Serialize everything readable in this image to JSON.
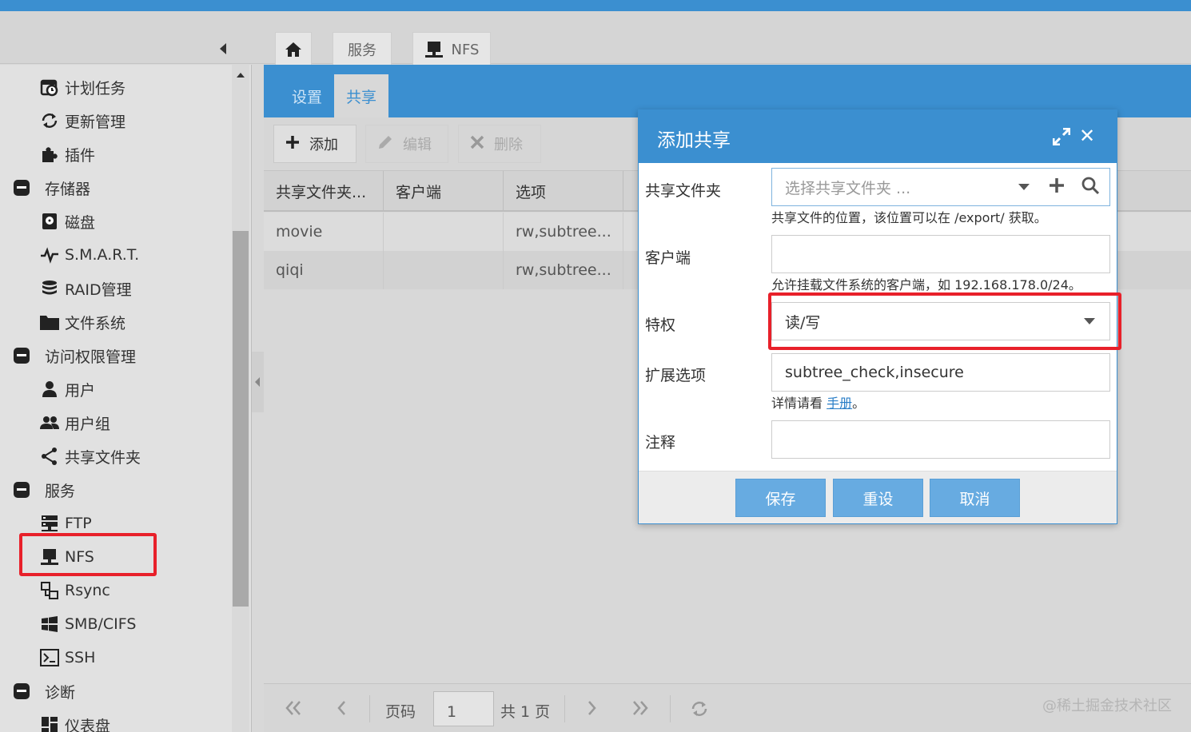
{
  "breadcrumb": {
    "service": "服务",
    "nfs": "NFS"
  },
  "sidebar": {
    "items": [
      {
        "label": "计划任务"
      },
      {
        "label": "更新管理"
      },
      {
        "label": "插件"
      },
      {
        "label": "存储器"
      },
      {
        "label": "磁盘"
      },
      {
        "label": "S.M.A.R.T."
      },
      {
        "label": "RAID管理"
      },
      {
        "label": "文件系统"
      },
      {
        "label": "访问权限管理"
      },
      {
        "label": "用户"
      },
      {
        "label": "用户组"
      },
      {
        "label": "共享文件夹"
      },
      {
        "label": "服务"
      },
      {
        "label": "FTP"
      },
      {
        "label": "NFS"
      },
      {
        "label": "Rsync"
      },
      {
        "label": "SMB/CIFS"
      },
      {
        "label": "SSH"
      },
      {
        "label": "诊断"
      },
      {
        "label": "仪表盘"
      }
    ]
  },
  "tabs": {
    "settings": "设置",
    "share": "共享"
  },
  "toolbar": {
    "add": "添加",
    "edit": "编辑",
    "delete": "删除"
  },
  "grid": {
    "columns": [
      "共享文件夹...",
      "客户端",
      "选项"
    ],
    "rows": [
      {
        "folder": "movie",
        "client": "",
        "options": "rw,subtree..."
      },
      {
        "folder": "qiqi",
        "client": "",
        "options": "rw,subtree..."
      }
    ]
  },
  "pager": {
    "page_label": "页码",
    "page_value": "1",
    "total": "共 1 页"
  },
  "dialog": {
    "title": "添加共享",
    "folder_label": "共享文件夹",
    "folder_placeholder": "选择共享文件夹 ...",
    "folder_hint": "共享文件的位置，该位置可以在 /export/ 获取。",
    "client_label": "客户端",
    "client_value": "",
    "client_hint": "允许挂载文件系统的客户端，如 192.168.178.0/24。",
    "priv_label": "特权",
    "priv_value": "读/写",
    "ext_label": "扩展选项",
    "ext_value": "subtree_check,insecure",
    "ext_hint_prefix": "详情请看",
    "ext_hint_link": "手册",
    "ext_hint_suffix": "。",
    "comment_label": "注释",
    "comment_value": "",
    "save": "保存",
    "reset": "重设",
    "cancel": "取消"
  },
  "watermark": "@稀土掘金技术社区",
  "colors": {
    "accent": "#3b8fd0",
    "button": "#67abe1",
    "highlight_box": "#e8202a"
  }
}
